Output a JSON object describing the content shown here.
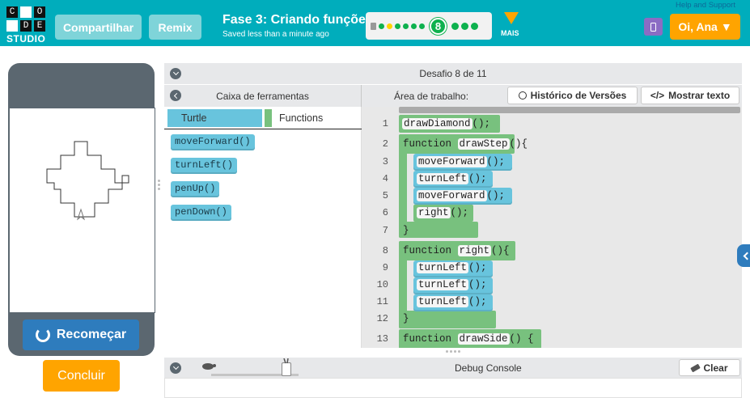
{
  "header": {
    "help_link": "Help and Support",
    "logo_letters": [
      "C",
      "O",
      "D",
      "E"
    ],
    "logo_studio": "STUDIO",
    "share_label": "Compartilhar",
    "remix_label": "Remix",
    "lesson_title": "Fase 3: Criando funções",
    "save_status": "Saved less than a minute ago",
    "current_level": "8",
    "more_label": "MAIS",
    "user_label": "Oi, Ana",
    "user_caret": "▼"
  },
  "visualization": {
    "reset_label": "Recomeçar",
    "finish_label": "Concluir"
  },
  "workspace": {
    "challenge_label": "Desafio 8 de 11",
    "toolbox_title": "Caixa de ferramentas",
    "workspace_title": "Área de trabalho:",
    "history_label": "Histórico de Versões",
    "show_text_label": "Mostrar texto"
  },
  "toolbox": {
    "categories": [
      "Turtle",
      "Functions"
    ],
    "blocks": [
      "moveForward()",
      "turnLeft()",
      "penUp()",
      "penDown()"
    ]
  },
  "code": {
    "line_numbers": [
      "1",
      "2",
      "3",
      "4",
      "5",
      "6",
      "7",
      "8",
      "9",
      "10",
      "11",
      "12",
      "13"
    ],
    "lines": {
      "l1_call": "drawDiamond",
      "l1_rest": "();",
      "l2_kw": "function",
      "l2_name": "drawStep",
      "l2_rest": "(){",
      "l3_call": "moveForward",
      "l3_rest": "();",
      "l4_call": "turnLeft",
      "l4_rest": "();",
      "l5_call": "moveForward",
      "l5_rest": "();",
      "l6_call": "right",
      "l6_rest": "();",
      "l7_close": "}",
      "l8_kw": "function",
      "l8_name": "right",
      "l8_rest": "(){",
      "l9_call": "turnLeft",
      "l9_rest": "();",
      "l10_call": "turnLeft",
      "l10_rest": "();",
      "l11_call": "turnLeft",
      "l11_rest": "();",
      "l12_close": "}",
      "l13_kw": "function",
      "l13_name": "drawSide",
      "l13_rest": "() {"
    }
  },
  "debug": {
    "label": "Debug Console",
    "clear_label": "Clear"
  },
  "colors": {
    "header_teal": "#00adbc",
    "accent_orange": "#ffa400",
    "function_green": "#78c17e",
    "turtle_blue": "#68c4dd",
    "panel_gray": "#5b6770",
    "progress_green": "#0eb14e"
  }
}
